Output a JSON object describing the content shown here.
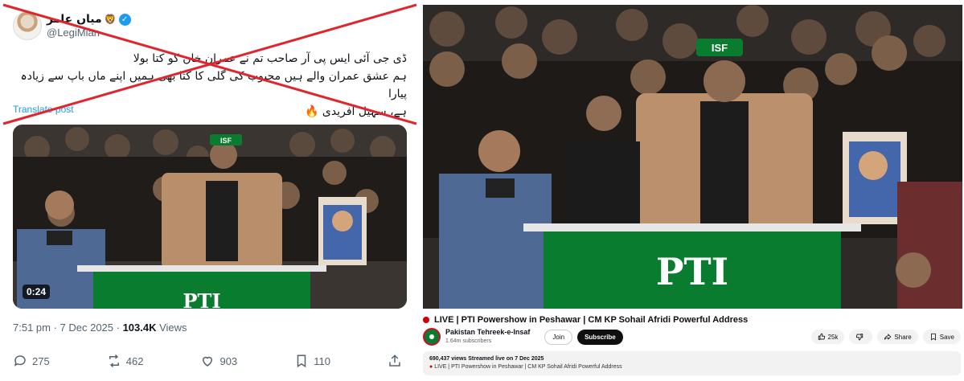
{
  "twitter": {
    "display_name": "میاں عامر",
    "handle": "@LegiMian",
    "post_lines": [
      "ڈی جی آئی ایس پی آر صاحب تم نے عمران خان کو کتا بولا",
      "ہم عشق عمران والے ہیں محبوب کی گلی کا کتا بھی ہمیں اپنے ماں باپ سے زیادہ پیارا",
      "ہے، سہیل آفریدی 🔥"
    ],
    "translate_label": "Translate post",
    "video_duration": "0:24",
    "time": "7:51 pm · 7 Dec 2025 · ",
    "views_count": "103.4K",
    "views_label": " Views",
    "replies": "275",
    "reposts": "462",
    "likes": "903",
    "bookmarks": "110",
    "video_text": "PTI",
    "poster_text": "ISF"
  },
  "youtube": {
    "video_text": "PTI",
    "cap_text": "ISF",
    "title": "LIVE | PTI Powershow in Peshawar | CM KP Sohail Afridi Powerful Address",
    "channel_name": "Pakistan Tehreek-e-Insaf",
    "subscribers": "1.64m subscribers",
    "join_label": "Join",
    "subscribe_label": "Subscribe",
    "likes": "25k",
    "share_label": "Share",
    "save_label": "Save",
    "desc_stats": "690,437 views  Streamed live on 7 Dec 2025",
    "desc_title": "LIVE | PTI Powershow in Peshawar | CM KP Sohail Afridi Powerful Address"
  },
  "colors": {
    "cross_red": "#e0262c",
    "x_blue": "#1d9bf0",
    "pti_green": "#0a7c2f",
    "yt_red": "#cc0000"
  }
}
